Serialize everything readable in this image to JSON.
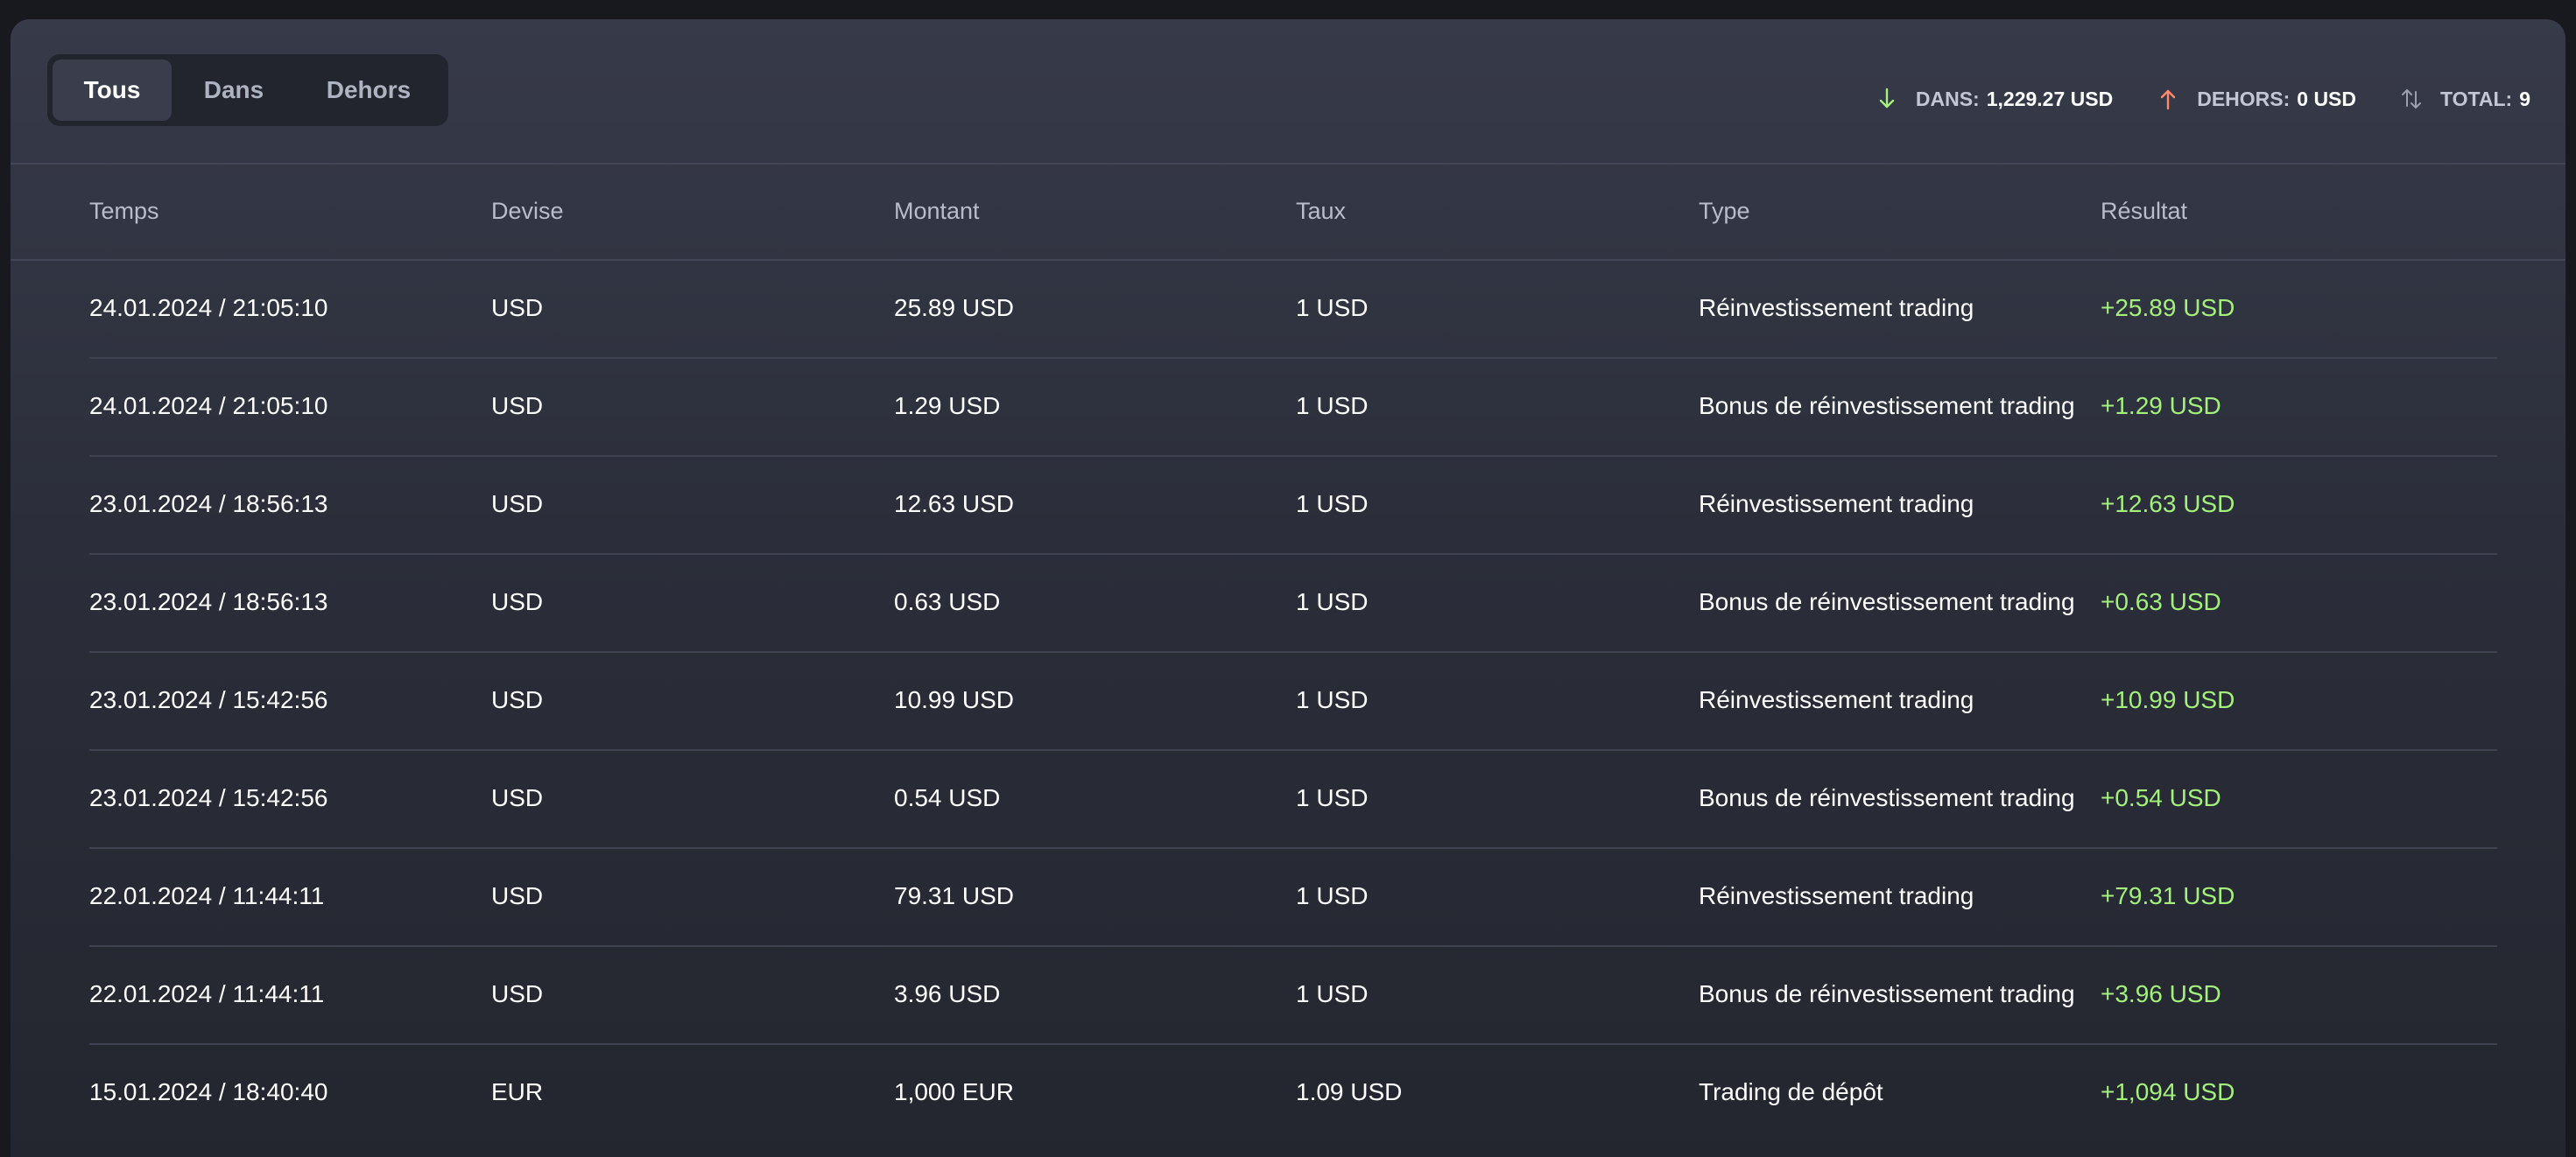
{
  "tabs": [
    "Tous",
    "Dans",
    "Dehors"
  ],
  "active_tab": "Tous",
  "stats": {
    "in_label": "DANS:",
    "in_value": "1,229.27 USD",
    "out_label": "DEHORS:",
    "out_value": "0 USD",
    "total_label": "TOTAL:",
    "total_value": "9"
  },
  "colors": {
    "in_arrow": "#a4f07c",
    "out_arrow": "#ff8a6b",
    "total_arrow": "#9aa0b0",
    "result": "#a4f07c"
  },
  "icons": {
    "in": "arrow-down-icon",
    "out": "arrow-up-icon",
    "total": "arrows-up-down-icon"
  },
  "table": {
    "columns": [
      "Temps",
      "Devise",
      "Montant",
      "Taux",
      "Type",
      "Résultat"
    ],
    "rows": [
      [
        "24.01.2024 / 21:05:10",
        "USD",
        "25.89 USD",
        "1 USD",
        "Réinvestissement trading",
        "+25.89 USD"
      ],
      [
        "24.01.2024 / 21:05:10",
        "USD",
        "1.29 USD",
        "1 USD",
        "Bonus de réinvestissement trading",
        "+1.29 USD"
      ],
      [
        "23.01.2024 / 18:56:13",
        "USD",
        "12.63 USD",
        "1 USD",
        "Réinvestissement trading",
        "+12.63 USD"
      ],
      [
        "23.01.2024 / 18:56:13",
        "USD",
        "0.63 USD",
        "1 USD",
        "Bonus de réinvestissement trading",
        "+0.63 USD"
      ],
      [
        "23.01.2024 / 15:42:56",
        "USD",
        "10.99 USD",
        "1 USD",
        "Réinvestissement trading",
        "+10.99 USD"
      ],
      [
        "23.01.2024 / 15:42:56",
        "USD",
        "0.54 USD",
        "1 USD",
        "Bonus de réinvestissement trading",
        "+0.54 USD"
      ],
      [
        "22.01.2024 / 11:44:11",
        "USD",
        "79.31 USD",
        "1 USD",
        "Réinvestissement trading",
        "+79.31 USD"
      ],
      [
        "22.01.2024 / 11:44:11",
        "USD",
        "3.96 USD",
        "1 USD",
        "Bonus de réinvestissement trading",
        "+3.96 USD"
      ],
      [
        "15.01.2024 / 18:40:40",
        "EUR",
        "1,000 EUR",
        "1.09 USD",
        "Trading de dépôt",
        "+1,094 USD"
      ]
    ]
  }
}
